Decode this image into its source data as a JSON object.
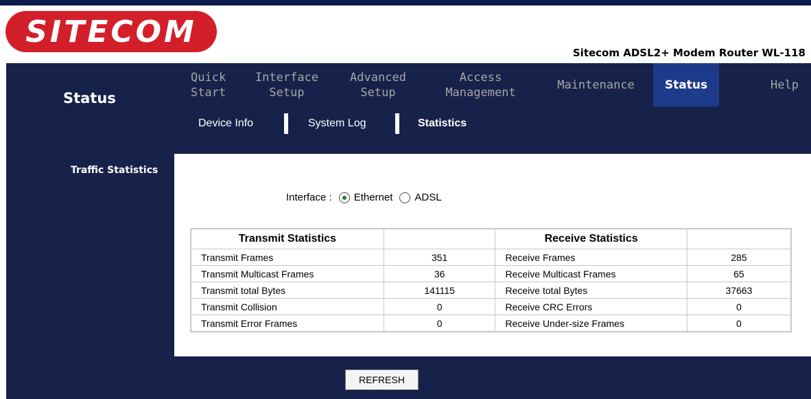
{
  "brand": {
    "logo_text": "SITECOM",
    "model": "Sitecom ADSL2+ Modem Router WL-118"
  },
  "sidebar": {
    "title": "Status",
    "section": "Traffic Statistics"
  },
  "nav": [
    {
      "label": "Quick\nStart"
    },
    {
      "label": "Interface\nSetup"
    },
    {
      "label": "Advanced\nSetup"
    },
    {
      "label": "Access\nManagement"
    },
    {
      "label": "Maintenance"
    },
    {
      "label": "Status"
    },
    {
      "label": "Help"
    }
  ],
  "subnav": {
    "device_info": "Device Info",
    "system_log": "System Log",
    "statistics": "Statistics"
  },
  "interface": {
    "label": "Interface :",
    "option1": "Ethernet",
    "option2": "ADSL",
    "selected": "Ethernet"
  },
  "table": {
    "transmit_header": "Transmit Statistics",
    "receive_header": "Receive Statistics",
    "rows": [
      {
        "tx_label": "Transmit Frames",
        "tx_value": "351",
        "rx_label": "Receive Frames",
        "rx_value": "285"
      },
      {
        "tx_label": "Transmit Multicast Frames",
        "tx_value": "36",
        "rx_label": "Receive Multicast Frames",
        "rx_value": "65"
      },
      {
        "tx_label": "Transmit total Bytes",
        "tx_value": "141115",
        "rx_label": "Receive total Bytes",
        "rx_value": "37663"
      },
      {
        "tx_label": "Transmit Collision",
        "tx_value": "0",
        "rx_label": "Receive CRC Errors",
        "rx_value": "0"
      },
      {
        "tx_label": "Transmit Error Frames",
        "tx_value": "0",
        "rx_label": "Receive Under-size Frames",
        "rx_value": "0"
      }
    ]
  },
  "refresh_label": "REFRESH",
  "colors": {
    "navy": "#17224a",
    "active_tab": "#1e3a8a",
    "logo_red": "#d31f2a"
  }
}
